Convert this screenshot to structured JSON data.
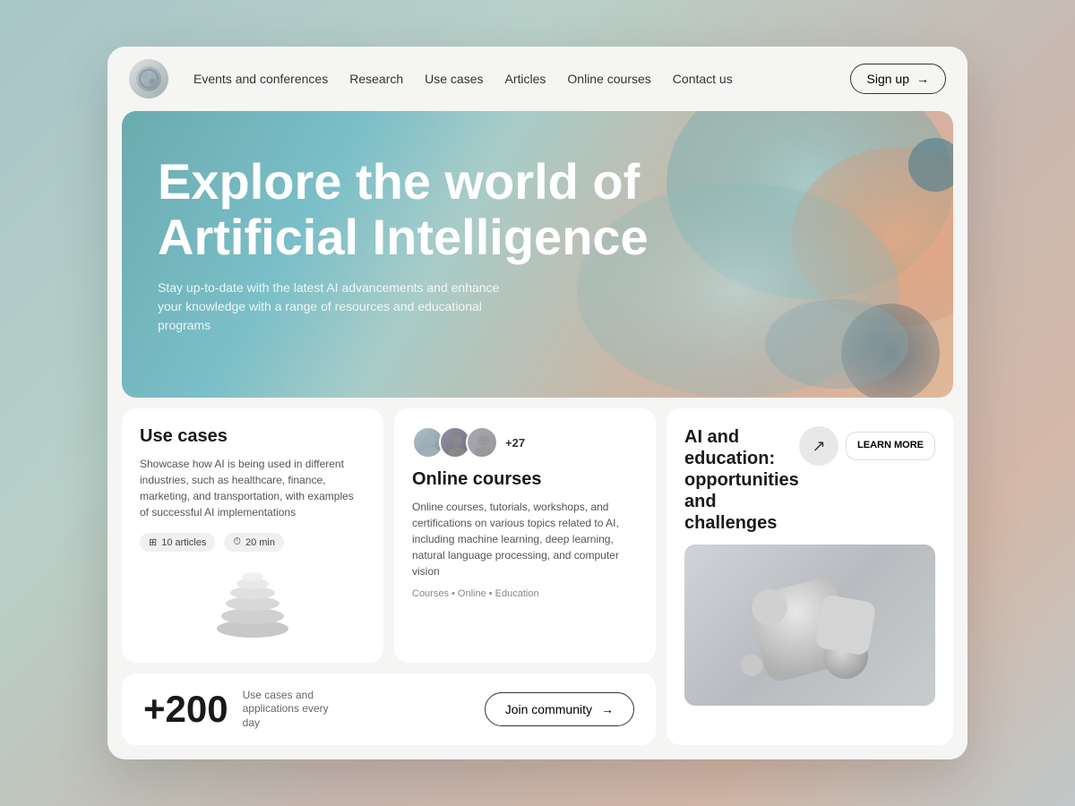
{
  "nav": {
    "links": [
      {
        "label": "Events and conferences"
      },
      {
        "label": "Research"
      },
      {
        "label": "Use cases"
      },
      {
        "label": "Articles"
      },
      {
        "label": "Online courses"
      },
      {
        "label": "Contact us"
      }
    ],
    "signup_label": "Sign up"
  },
  "hero": {
    "title": "Explore the world of Artificial Intelligence",
    "subtitle": "Stay up-to-date with the latest AI advancements and enhance your knowledge with a range of resources and educational programs"
  },
  "use_cases": {
    "title": "Use cases",
    "description": "Showcase how AI is being used in different industries, such as healthcare, finance, marketing, and transportation, with examples of successful AI implementations",
    "tag1_label": "10 articles",
    "tag2_label": "20 min"
  },
  "online_courses": {
    "avatar_count": "+27",
    "title": "Online courses",
    "description": "Online courses, tutorials, workshops, and certifications on various topics related to AI, including machine learning, deep learning, natural language processing, and computer vision",
    "tags": "Courses • Online • Education"
  },
  "ai_education": {
    "title": "AI and education: opportunities and challenges",
    "learn_more_label": "LEARN MORE",
    "arrow": "↗"
  },
  "stats": {
    "number": "+200",
    "description": "Use cases and applications every day",
    "join_label": "Join community",
    "join_arrow": "→"
  }
}
